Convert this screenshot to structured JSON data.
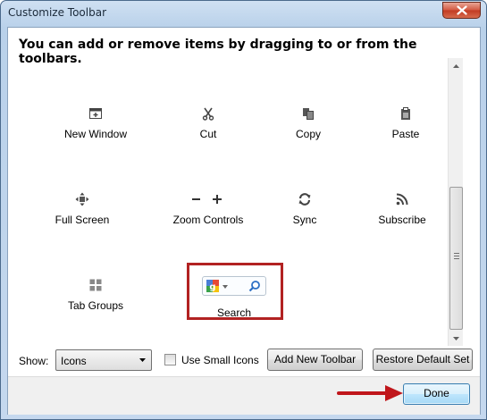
{
  "window": {
    "title": "Customize Toolbar"
  },
  "instructions": "You can add or remove items by dragging to or from the toolbars.",
  "palette_items": [
    {
      "label": "New Window",
      "icon": "new-window-icon"
    },
    {
      "label": "Cut",
      "icon": "scissors-icon"
    },
    {
      "label": "Copy",
      "icon": "copy-icon"
    },
    {
      "label": "Paste",
      "icon": "paste-icon"
    },
    {
      "label": "Full Screen",
      "icon": "fullscreen-icon"
    },
    {
      "label": "Zoom Controls",
      "icon": "zoom-controls-icon"
    },
    {
      "label": "Sync",
      "icon": "sync-icon"
    },
    {
      "label": "Subscribe",
      "icon": "rss-icon"
    },
    {
      "label": "Tab Groups",
      "icon": "tab-groups-icon"
    },
    {
      "label": "Search",
      "icon": "search-engine-icon"
    }
  ],
  "controls": {
    "show_label": "Show:",
    "show_value": "Icons",
    "use_small_icons_label": "Use Small Icons",
    "use_small_icons_checked": false,
    "add_toolbar_label": "Add New Toolbar",
    "restore_label": "Restore Default Set"
  },
  "footer": {
    "done_label": "Done"
  },
  "colors": {
    "highlight": "#b22222",
    "arrow": "#c0161b"
  }
}
